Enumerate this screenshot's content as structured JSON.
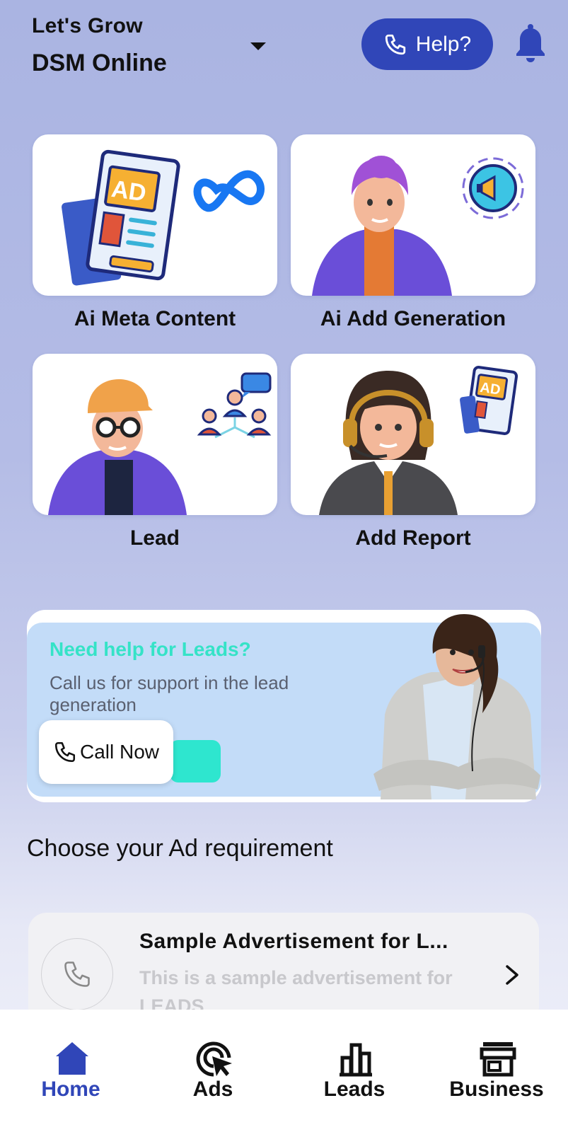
{
  "header": {
    "subtitle": "Let's Grow",
    "brand": "DSM Online",
    "help_label": "Help?",
    "accent_color": "#3046b8"
  },
  "features": [
    {
      "label": "Ai Meta Content",
      "icon": "ad-newspaper-icon"
    },
    {
      "label": "Ai Add Generation",
      "icon": "megaphone-icon"
    },
    {
      "label": "Lead",
      "icon": "network-icon"
    },
    {
      "label": "Add Report",
      "icon": "ad-newspaper-icon"
    }
  ],
  "banner": {
    "title": "Need help for  Leads?",
    "text": "Call us for support in the lead generation",
    "button_label": "Call Now",
    "title_color": "#35e3c7"
  },
  "section_title": "Choose your Ad requirement",
  "ads": [
    {
      "title": "Sample Advertisement for L...",
      "description": "This is a sample advertisement for LEADS.",
      "icon": "phone-icon"
    }
  ],
  "nav": {
    "items": [
      {
        "label": "Home",
        "icon": "home-icon",
        "active": true
      },
      {
        "label": "Ads",
        "icon": "cursor-target-icon",
        "active": false
      },
      {
        "label": "Leads",
        "icon": "bar-chart-icon",
        "active": false
      },
      {
        "label": "Business",
        "icon": "store-icon",
        "active": false
      }
    ]
  }
}
